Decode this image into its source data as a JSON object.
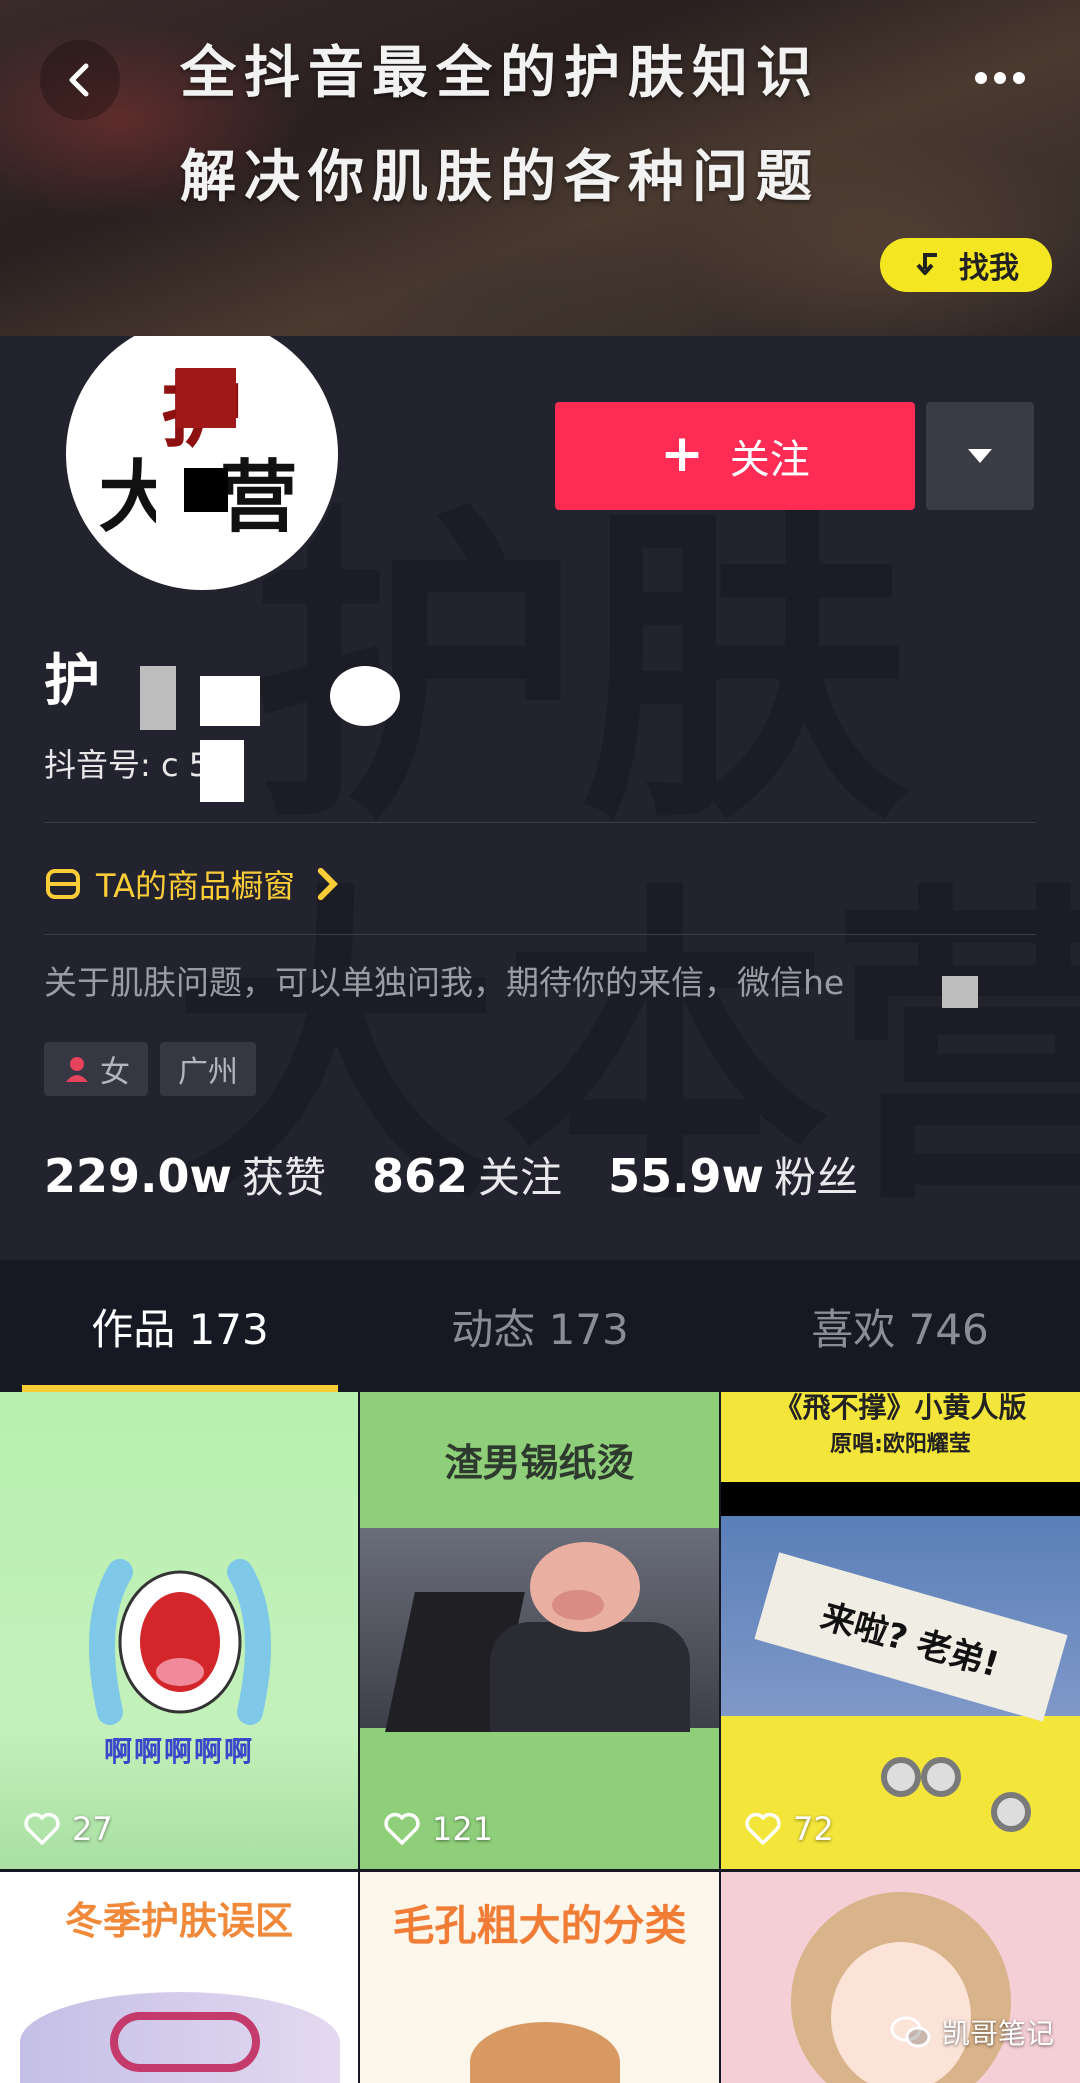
{
  "banner": {
    "line1": "全抖音最全的护肤知识",
    "line2": "解决你肌肤的各种问题",
    "find_me": "找我"
  },
  "avatar": {
    "char_top": "护",
    "char_bottom": "大  营"
  },
  "watermark": {
    "line1": "护肤",
    "line2": "大本营"
  },
  "follow": {
    "label": "关注",
    "plus": "+"
  },
  "profile": {
    "nickname": "护",
    "douyin_id": "抖音号: c      5",
    "shop": "TA的商品橱窗",
    "bio": "关于肌肤问题，可以单独问我，期待你的来信，微信he",
    "tags": [
      {
        "label": "女",
        "icon": "female-icon"
      },
      {
        "label": "广州"
      }
    ]
  },
  "stats": [
    {
      "num": "229.0w",
      "label": "获赞"
    },
    {
      "num": "862",
      "label": "关注"
    },
    {
      "num": "55.9w",
      "label": "粉丝"
    }
  ],
  "tabs": [
    {
      "label": "作品 173",
      "active": true
    },
    {
      "label": "动态 173",
      "active": false
    },
    {
      "label": "喜欢 746",
      "active": false
    }
  ],
  "videos": [
    {
      "caption": "啊啊啊啊啊",
      "likes": "27"
    },
    {
      "caption": "渣男锡纸烫",
      "likes": "121"
    },
    {
      "caption": "《飛不撑》小黄人版",
      "sub": "原唱:欧阳耀莹",
      "sign": "来啦? 老弟!",
      "likes": "72"
    },
    {
      "caption": "冬季护肤误区"
    },
    {
      "caption": "毛孔粗大的分类"
    },
    {
      "caption": ""
    }
  ],
  "wechat_watermark": "凯哥笔记",
  "colors": {
    "accent": "#fe2c55",
    "tab_indicator": "#facc37",
    "find_me": "#f4e621"
  }
}
